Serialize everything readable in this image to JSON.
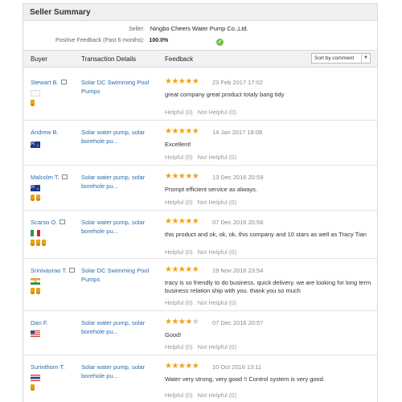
{
  "seller_summary": {
    "title": "Seller Summary",
    "seller_label": "Seller:",
    "seller_name": "Ningbo Cheers Water Pump Co.,Ltd.",
    "positive_label": "Positive Feedback (Past 6 months):",
    "positive_value": "100.0%"
  },
  "table": {
    "col_buyer": "Buyer",
    "col_transaction": "Transaction Details",
    "col_feedback": "Feedback",
    "sort_label": "Sort by comment",
    "helpful_label": "Helpful (0)",
    "not_helpful_label": "Not Helpful (0)"
  },
  "reviews": [
    {
      "buyer": "Stewart B.",
      "product": "Solar DC Swimming Pool Pumps",
      "rating": 5,
      "date": "23 Feb 2017 17:02",
      "comment": "great company great product totaly bang tidy",
      "flag": "none",
      "medals": 1
    },
    {
      "buyer": "Andrew B.",
      "product": "Solar water pump, solar borehole pu...",
      "rating": 5,
      "date": "14 Jan 2017 18:08",
      "comment": "Excellent!",
      "flag": "au",
      "medals": 0
    },
    {
      "buyer": "Malcolm T.",
      "product": "Solar water pump, solar borehole pu...",
      "rating": 5,
      "date": "13 Dec 2016 20:59",
      "comment": "Prompt efficient service as always.",
      "flag": "au",
      "medals": 2
    },
    {
      "buyer": "Scarso O.",
      "product": "Solar water pump, solar borehole pu...",
      "rating": 5,
      "date": "07 Dec 2016 20:58",
      "comment": "this product and ok, ok, ok, this company and 10 stars as well as Tracy Tian",
      "flag": "it",
      "medals": 3
    },
    {
      "buyer": "Srinivasrao T.",
      "product": "Solar DC Swimming Pool Pumps",
      "rating": 5,
      "date": "19 Nov 2016 23:54",
      "comment": "tracy is so friendly to do business. quick delivery. we are looking for long term business relation ship with you. thank you so much",
      "flag": "in",
      "medals": 2
    },
    {
      "buyer": "Dan F.",
      "product": "Solar water pump, solar borehole pu...",
      "rating": 4,
      "date": "07 Dec 2016 20:57",
      "comment": "Good!",
      "flag": "us",
      "medals": 0
    },
    {
      "buyer": "Surinthorn T.",
      "product": "Solar water pump, solar borehole pu...",
      "rating": 5,
      "date": "10 Oct 2016 13:11",
      "comment": "Water very strong, very good !! Control system is very good.",
      "flag": "th",
      "medals": 1
    }
  ]
}
